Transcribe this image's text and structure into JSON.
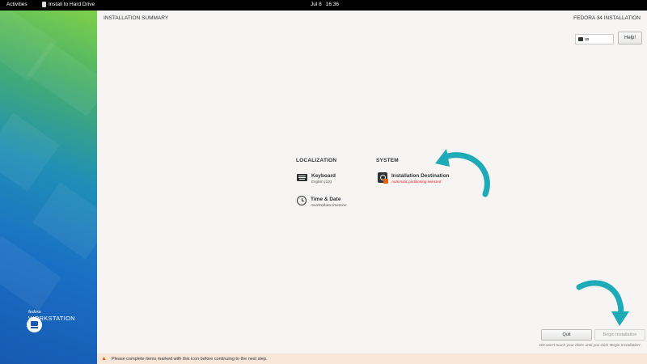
{
  "topbar": {
    "activities": "Activities",
    "app": "Install to Hard Drive",
    "date": "Jul 8",
    "time": "16:36"
  },
  "sidebar": {
    "brand_small": "fedora",
    "brand_big": "WORKSTATION"
  },
  "header": {
    "title": "INSTALLATION SUMMARY",
    "product": "FEDORA 34 INSTALLATION",
    "keyboard_layout": "us",
    "help": "Help!"
  },
  "localization": {
    "heading": "LOCALIZATION",
    "items": [
      {
        "label": "Keyboard",
        "status": "English (US)",
        "icon": "keyboard-icon"
      },
      {
        "label": "Time & Date",
        "status": "Asia/Kolkata timezone",
        "icon": "clock-icon"
      }
    ]
  },
  "system": {
    "heading": "SYSTEM",
    "items": [
      {
        "label": "Installation Destination",
        "status": "Automatic partitioning selected",
        "icon": "hard-disk-warning-icon"
      }
    ]
  },
  "footer": {
    "quit": "Quit",
    "begin": "Begin Installation",
    "note": "We won't touch your disks until you click 'Begin Installation'.",
    "warning": "Please complete items marked with this icon before continuing to the next step."
  },
  "colors": {
    "accent": "#1eaab7",
    "warning": "#e01b24",
    "warning_bar": "#f8e7d8"
  }
}
